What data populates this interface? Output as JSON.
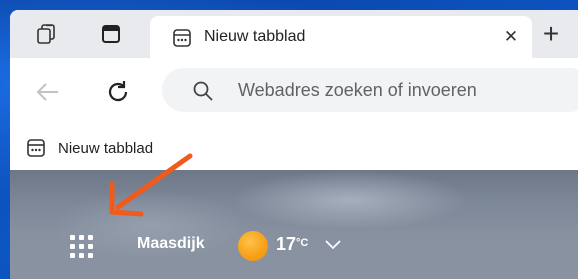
{
  "tab": {
    "title": "Nieuw tabblad",
    "close_symbol": "✕"
  },
  "newtab_symbol": "+",
  "address": {
    "placeholder": "Webadres zoeken of invoeren"
  },
  "favorites": {
    "items": [
      {
        "label": "Nieuw tabblad",
        "icon": "newtab-page-icon"
      }
    ]
  },
  "weather": {
    "location": "Maasdijk",
    "temperature": "17",
    "unit": "°C",
    "icon": "sun-icon"
  },
  "icons": {
    "workspaces": "workspaces-icon",
    "tab_actions": "tab-actions-icon",
    "back": "back-arrow-icon",
    "refresh": "refresh-icon",
    "search": "search-icon",
    "apps": "app-launcher-icon",
    "annotation": "orange-arrow-annotation"
  },
  "colors": {
    "annotation": "#f25a1b",
    "sun": "#f7a21a",
    "desktop": "#0b4fb8"
  }
}
